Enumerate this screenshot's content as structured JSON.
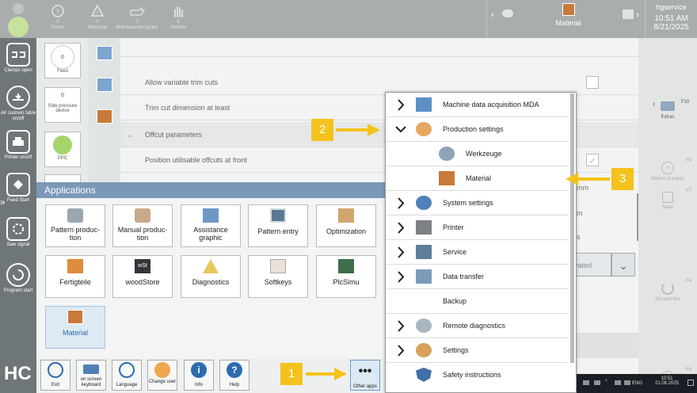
{
  "status_bar": {
    "errors": {
      "count": "0",
      "label": "Errors"
    },
    "warnings": {
      "count": "0",
      "label": "Warnings"
    },
    "maintenance": {
      "count": "0",
      "label": "Maintenance cycles"
    },
    "actions": {
      "count": "0",
      "label": "Actions"
    },
    "material_label": "Material",
    "user": "hgservice",
    "time": "10:51 AM",
    "date": "8/21/2025"
  },
  "left_sidebar": {
    "items": [
      {
        "label": "Clamps open",
        "icon": "clamp-icon"
      },
      {
        "label": "Air cushion table on/off",
        "icon": "air-cushion-icon"
      },
      {
        "label": "Printer on/off",
        "icon": "printer-icon"
      },
      {
        "label": "Feed Start",
        "icon": "feed-start-icon"
      },
      {
        "label": "Saw signal",
        "icon": "saw-signal-icon"
      },
      {
        "label": "Program start",
        "icon": "program-start-icon"
      }
    ]
  },
  "feed_panel": {
    "feed": {
      "value": "0",
      "label": "Feed"
    },
    "side_pressure": {
      "value": "0",
      "label": "Side pressure device"
    },
    "ppc_label": "PPC"
  },
  "settings_rows": {
    "row0": "",
    "row1": "Allow variable trim cuts",
    "row2": "Trim cut dimension at least",
    "row3": "Offcut parameters",
    "row4": "Position utilisable offcuts at front"
  },
  "right_panel": {
    "extras_key": "F10",
    "extras": "Extras",
    "reject_key": "F6",
    "reject": "Reject changes",
    "save_key": "F7",
    "save": "Save",
    "discard_key": "F4",
    "discard": "Discard line",
    "f8_key": "F8",
    "partial_mm": "mm",
    "partial_m": "m",
    "partial_s": "s",
    "partial_vated": "vated"
  },
  "applications": {
    "title": "Applications",
    "tiles": [
      {
        "label": "Pattern produc-\ntion"
      },
      {
        "label": "Manual produc-\ntion"
      },
      {
        "label": "Assistance\ngraphic"
      },
      {
        "label": "Pattern entry"
      },
      {
        "label": "Optimization"
      },
      {
        "label": "Fertigteile"
      },
      {
        "label": "woodStore"
      },
      {
        "label": "Diagnostics"
      },
      {
        "label": "Softkeys"
      },
      {
        "label": "PlcSimu"
      },
      {
        "label": "Material"
      }
    ]
  },
  "toolbar": {
    "exit": "Exit",
    "keyboard": "on screen keyboard",
    "language": "Language",
    "change_user": "Change user",
    "info": "Info",
    "help": "Help",
    "other_apps": "Other apps"
  },
  "menu": {
    "items": [
      {
        "label": "Machine data acquisition MDA"
      },
      {
        "label": "Production settings"
      },
      {
        "label": "Werkzeuge"
      },
      {
        "label": "Material"
      },
      {
        "label": "System settings"
      },
      {
        "label": "Printer"
      },
      {
        "label": "Service"
      },
      {
        "label": "Data transfer"
      },
      {
        "label": "Backup"
      },
      {
        "label": "Remote diagnostics"
      },
      {
        "label": "Settings"
      },
      {
        "label": "Safety instructions"
      }
    ]
  },
  "callouts": {
    "one": "1",
    "two": "2",
    "three": "3"
  },
  "taskbar": {
    "lang": "ENG",
    "time": "10:51",
    "date": "21.08.2025"
  },
  "logo_text": "HC"
}
